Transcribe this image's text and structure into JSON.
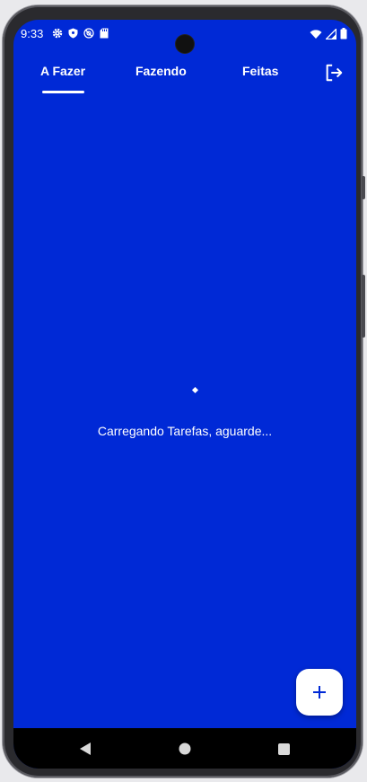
{
  "status_bar": {
    "time": "9:33",
    "left_icons": [
      "settings-icon",
      "shield-icon",
      "at-sign-icon",
      "sd-card-icon"
    ],
    "right_icons": [
      "wifi-icon",
      "signal-icon",
      "battery-icon"
    ]
  },
  "tabs": [
    {
      "label": "A Fazer",
      "selected": true
    },
    {
      "label": "Fazendo",
      "selected": false
    },
    {
      "label": "Feitas",
      "selected": false
    }
  ],
  "header": {
    "logout_icon": "logout-icon"
  },
  "main": {
    "loading_text": "Carregando Tarefas, aguarde..."
  },
  "fab": {
    "icon": "plus-icon"
  },
  "navigation": {
    "buttons": [
      "back-icon",
      "home-icon",
      "recents-icon"
    ]
  },
  "colors": {
    "background": "#0029d6",
    "text": "#ffffff",
    "fab_background": "#ffffff",
    "fab_icon": "#0029d6",
    "nav_bar": "#000000"
  }
}
